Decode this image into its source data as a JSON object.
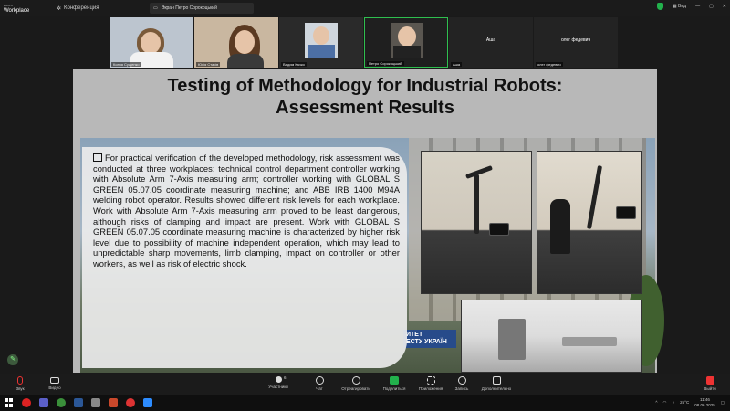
{
  "app": {
    "brand": "Workplace",
    "brand_sub": "zoom"
  },
  "topbar": {
    "conference_label": "Конференция",
    "speaker_label": "Экран Петро Сорокоцький",
    "view_label": "Вид"
  },
  "participants": [
    {
      "name": "Ксеня Сущенко"
    },
    {
      "name": "Юлія Стасів"
    },
    {
      "name": "Вадим Качко"
    },
    {
      "name": "Петро Сорокоцький"
    },
    {
      "name": "Аша",
      "center": "Аша"
    },
    {
      "name": "олег федевич",
      "center": "олег федевич"
    }
  ],
  "slide": {
    "title_line1": "Testing of Methodology for Industrial Robots:",
    "title_line2": "Assessment Results",
    "body": "For practical verification of the developed methodology, risk assessment was conducted at three workplaces: technical control department controller working with Absolute Arm 7-Axis measuring arm; controller working with GLOBAL S GREEN 05.07.05 coordinate measuring machine; and ABB IRB 1400 M94A welding robot operator. Results showed different risk levels for each workplace. Work with Absolute Arm 7-Axis measuring arm proved to be least dangerous, although risks of clamping and impact are present. Work with GLOBAL S GREEN 05.07.05 coordinate measuring machine is characterized by higher risk level due to possibility of machine independent operation, which may lead to unpredictable sharp movements, limb clamping, impact on controller or other workers, as well as risk of electric shock.",
    "sign_line1": "ИТЕТ",
    "sign_line2": "ЕСТУ УКРАЇН"
  },
  "toolbar": {
    "mic": "Звук",
    "video": "Видео",
    "participants": "Участники",
    "participants_count": "6",
    "chat": "Чат",
    "reactions": "Отреагировать",
    "share": "Поделиться",
    "apps": "Приложения",
    "record": "Запись",
    "more": "Дополнительно",
    "leave": "Выйти"
  },
  "taskbar": {
    "temp": "25°C",
    "time": "11:46",
    "date": "08.06.2025"
  },
  "colors": {
    "accent": "#22b14c",
    "danger": "#e33333"
  }
}
